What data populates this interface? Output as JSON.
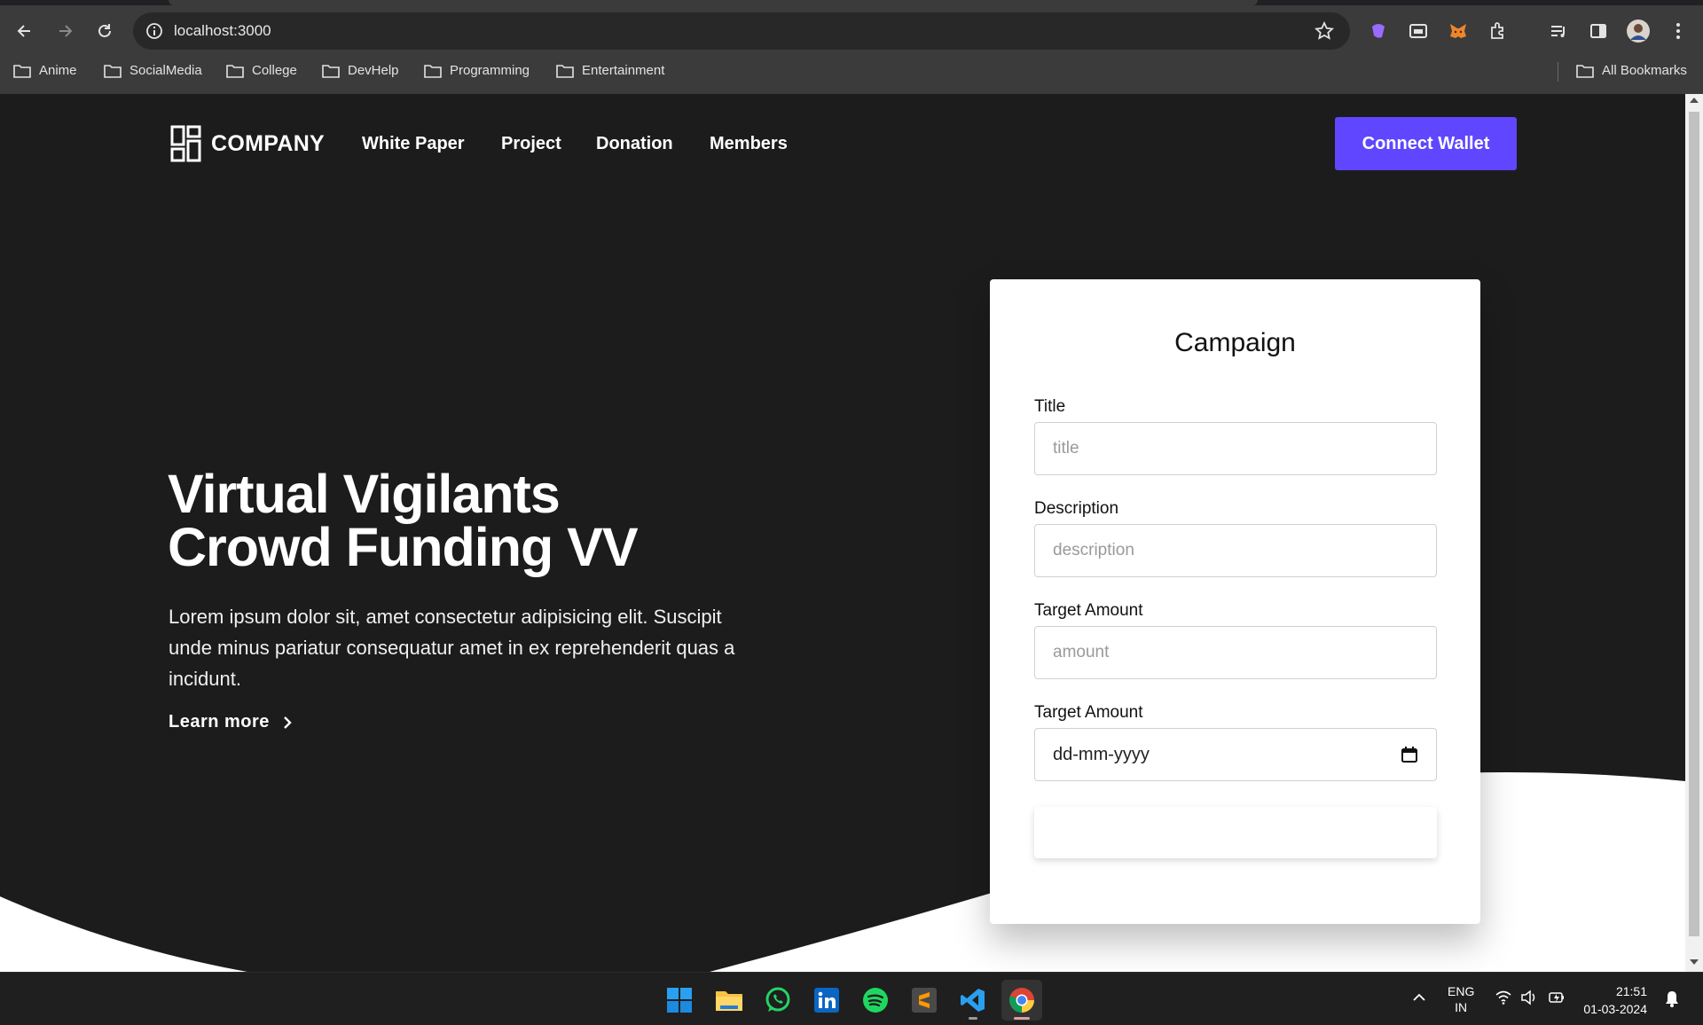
{
  "browser": {
    "url": "localhost:3000",
    "bookmarks": [
      "Anime",
      "SocialMedia",
      "College",
      "DevHelp",
      "Programming",
      "Entertainment"
    ],
    "all_bookmarks": "All Bookmarks"
  },
  "header": {
    "logo": "COMPANY",
    "nav": [
      "White Paper",
      "Project",
      "Donation",
      "Members"
    ],
    "connect": "Connect Wallet"
  },
  "hero": {
    "title_line1": "Virtual Vigilants",
    "title_line2": "Crowd Funding VV",
    "text": "Lorem ipsum dolor sit, amet consectetur adipisicing elit. Suscipit unde minus pariatur consequatur amet in ex reprehenderit quas a incidunt.",
    "learn_more": "Learn more"
  },
  "form": {
    "heading": "Campaign",
    "title_label": "Title",
    "title_placeholder": "title",
    "description_label": "Description",
    "description_placeholder": "description",
    "amount_label": "Target Amount",
    "amount_placeholder": "amount",
    "date_label": "Target Amount",
    "date_placeholder": "dd-mm-yyyy"
  },
  "taskbar": {
    "lang1": "ENG",
    "lang2": "IN",
    "time": "21:51",
    "date": "01-03-2024"
  },
  "colors": {
    "accent": "#6046ff",
    "background": "#1c1c1c"
  }
}
